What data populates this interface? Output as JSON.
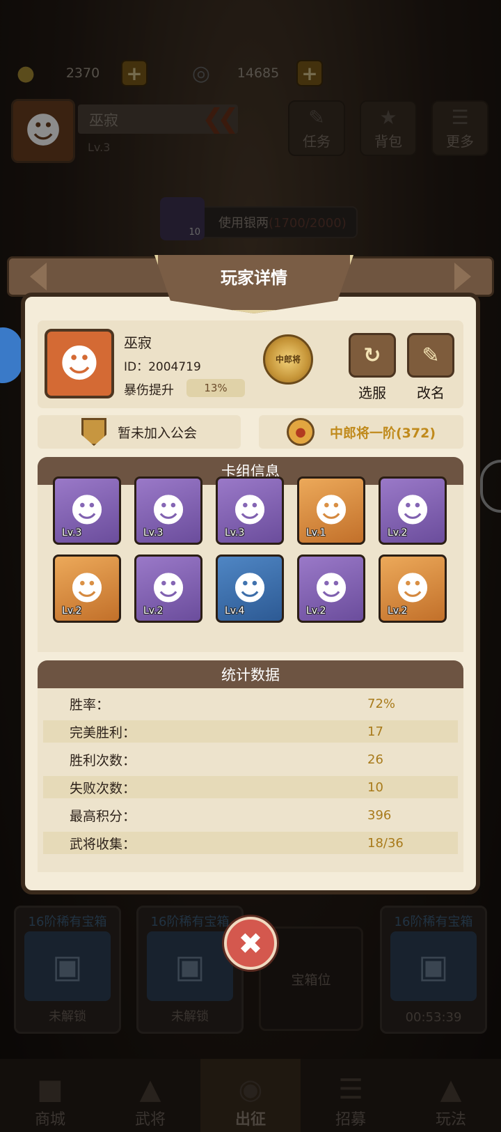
{
  "currency": [
    {
      "icon": "gold-ingot-icon",
      "value": "2370"
    },
    {
      "icon": "copper-coin-icon",
      "value": "14685"
    }
  ],
  "player_bar": {
    "name": "巫寂",
    "level": "Lv.3"
  },
  "top_buttons": [
    {
      "label": "任务",
      "icon": "scroll-icon"
    },
    {
      "label": "背包",
      "icon": "bag-icon"
    },
    {
      "label": "更多",
      "icon": "menu-icon"
    }
  ],
  "silver": {
    "count": "10",
    "label": "使用银两",
    "progress": "(1700/2000)"
  },
  "modal": {
    "title": "玩家详情",
    "profile": {
      "name": "巫寂",
      "id": "ID：2004719",
      "crit_label": "暴伤提升",
      "crit_value": "13%",
      "badge_text": "中郎将",
      "buttons": [
        {
          "label": "选服",
          "icon": "refresh-icon"
        },
        {
          "label": "改名",
          "icon": "pencil-icon"
        }
      ]
    },
    "guild": "暂未加入公会",
    "rank": "中郎将一阶(372)",
    "deck": {
      "title": "卡组信息",
      "cards": [
        {
          "lv": "Lv.3",
          "color": "purple"
        },
        {
          "lv": "Lv.3",
          "color": "purple"
        },
        {
          "lv": "Lv.3",
          "color": "purple"
        },
        {
          "lv": "Lv.1",
          "color": "orange"
        },
        {
          "lv": "Lv.2",
          "color": "purple"
        },
        {
          "lv": "Lv.2",
          "color": "orange"
        },
        {
          "lv": "Lv.2",
          "color": "purple"
        },
        {
          "lv": "Lv.4",
          "color": "blue"
        },
        {
          "lv": "Lv.2",
          "color": "purple"
        },
        {
          "lv": "Lv.2",
          "color": "orange"
        }
      ]
    },
    "stats": {
      "title": "统计数据",
      "rows": [
        {
          "k": "胜率：",
          "v": "72%"
        },
        {
          "k": "完美胜利：",
          "v": "17"
        },
        {
          "k": "胜利次数：",
          "v": "26"
        },
        {
          "k": "失败次数：",
          "v": "10"
        },
        {
          "k": "最高积分：",
          "v": "396"
        },
        {
          "k": "武将收集：",
          "v": "18/36"
        }
      ]
    }
  },
  "chests": [
    {
      "top": "16阶稀有宝箱",
      "bottom": "未解锁"
    },
    {
      "top": "16阶稀有宝箱",
      "bottom": "未解锁"
    },
    {
      "slot": "宝箱位"
    },
    {
      "top": "16阶稀有宝箱",
      "bottom": "00:53:39"
    }
  ],
  "nav": [
    {
      "label": "商城",
      "icon": "shop-icon"
    },
    {
      "label": "武将",
      "icon": "helmet-icon"
    },
    {
      "label": "出征",
      "icon": "battle-icon"
    },
    {
      "label": "招募",
      "icon": "recruit-icon"
    },
    {
      "label": "玩法",
      "icon": "palace-icon"
    }
  ]
}
